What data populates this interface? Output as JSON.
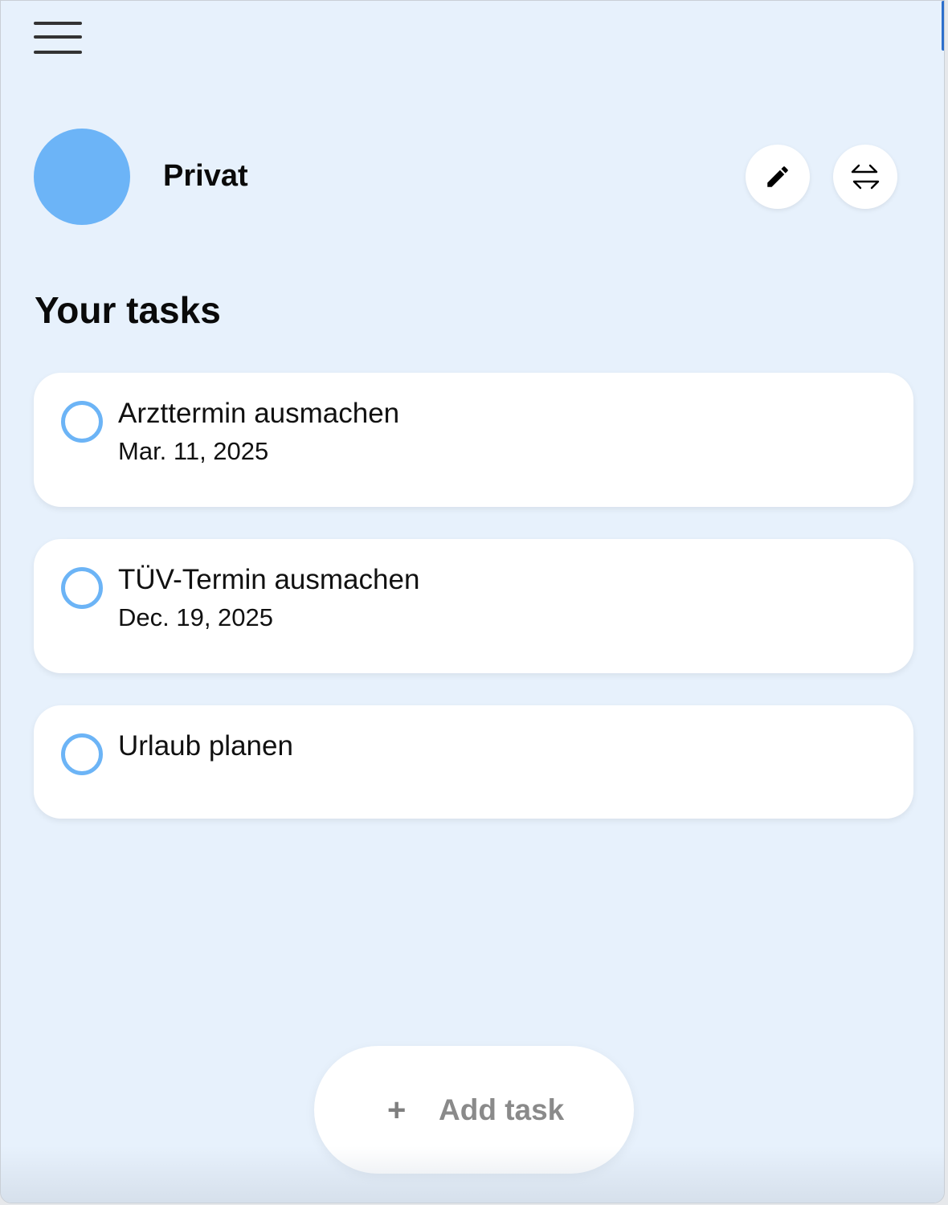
{
  "list": {
    "name": "Privat",
    "color": "#6cb4f7"
  },
  "header": {
    "menu_icon": "hamburger-menu-icon",
    "edit_icon": "pencil-icon",
    "switch_icon": "swap-arrows-icon"
  },
  "section_title": "Your tasks",
  "tasks": [
    {
      "title": "Arzttermin ausmachen",
      "date": "Mar. 11, 2025",
      "done": false
    },
    {
      "title": "TÜV-Termin ausmachen",
      "date": "Dec. 19, 2025",
      "done": false
    },
    {
      "title": "Urlaub planen",
      "date": "",
      "done": false
    }
  ],
  "add_task": {
    "plus": "+",
    "label": "Add task"
  },
  "colors": {
    "background": "#e7f1fc",
    "accent": "#6cb4f6",
    "card": "#ffffff"
  }
}
